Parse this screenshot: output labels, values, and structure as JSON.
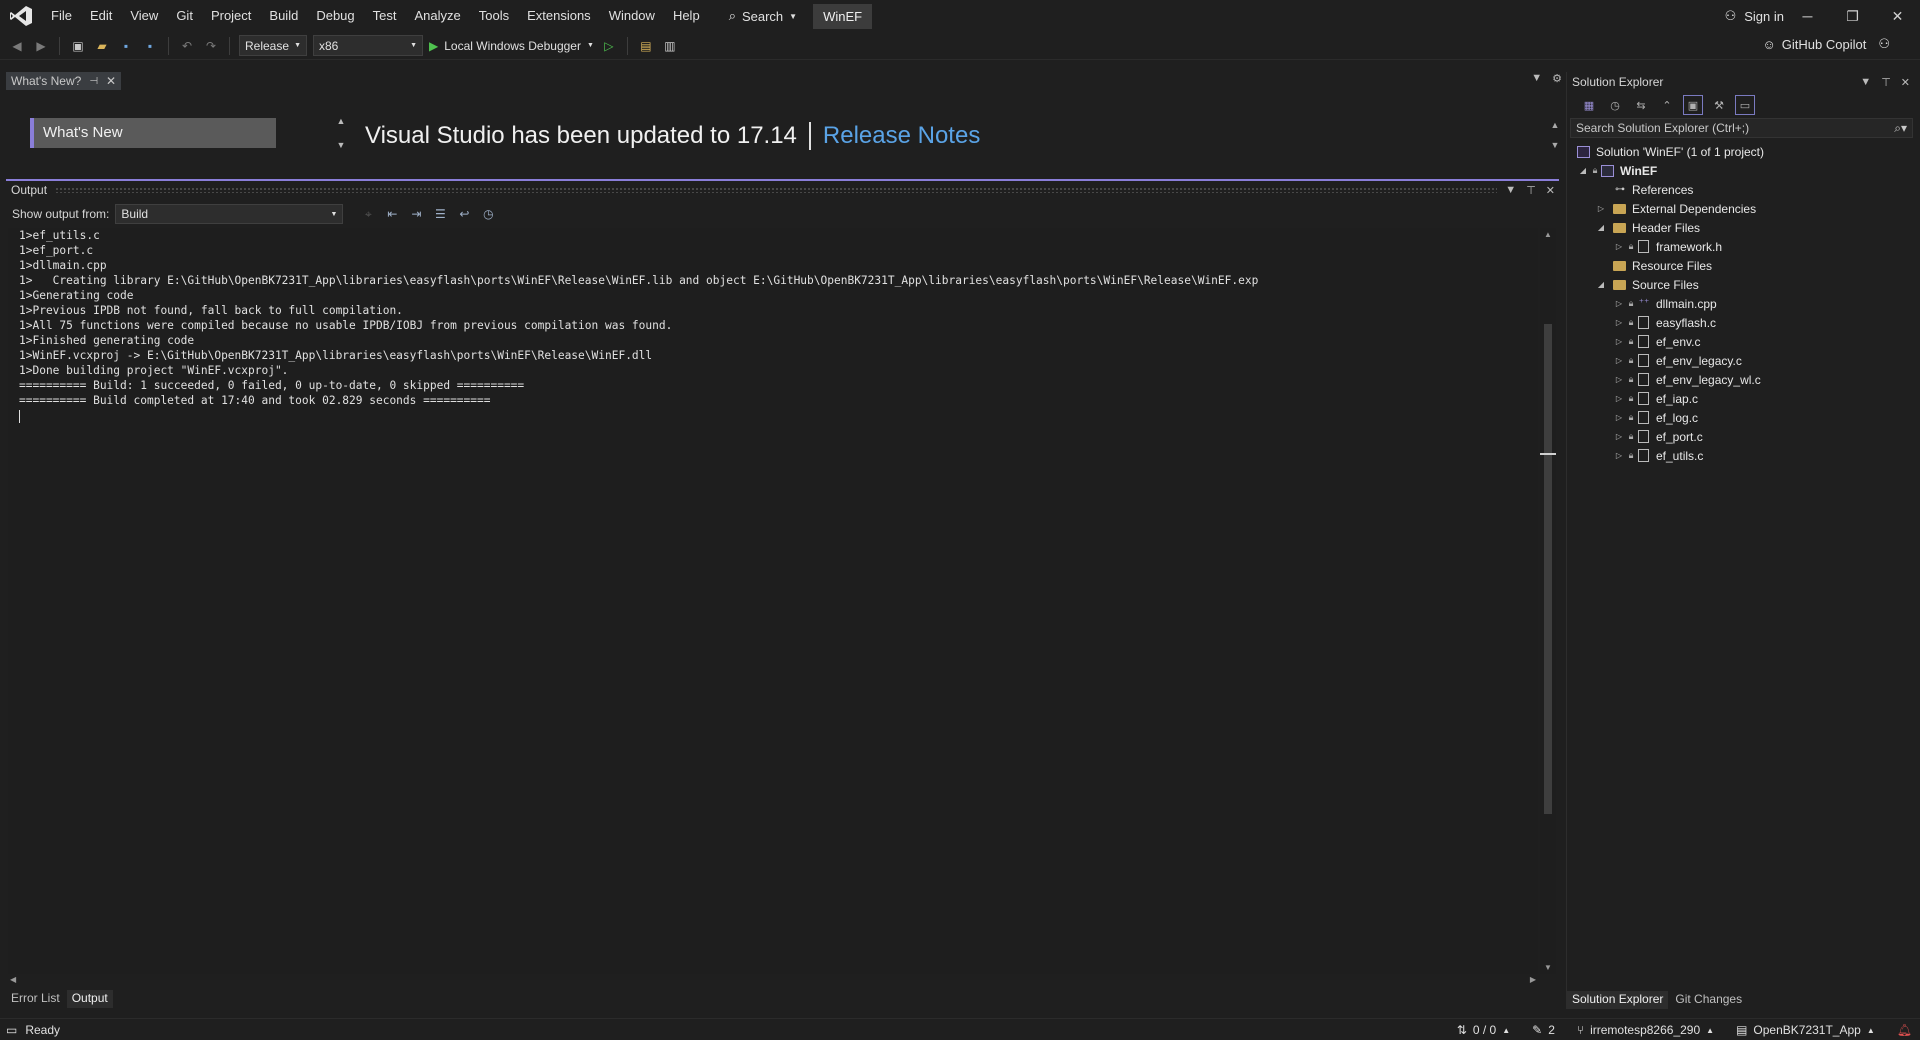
{
  "menu": {
    "items": [
      "File",
      "Edit",
      "View",
      "Git",
      "Project",
      "Build",
      "Debug",
      "Test",
      "Analyze",
      "Tools",
      "Extensions",
      "Window",
      "Help"
    ],
    "search_label": "Search",
    "solution_name": "WinEF",
    "sign_in": "Sign in"
  },
  "toolbar": {
    "configuration": "Release",
    "platform": "x86",
    "debugger": "Local Windows Debugger",
    "copilot": "GitHub Copilot"
  },
  "whats_new": {
    "tab_title": "What's New?",
    "button_label": "What's New",
    "headline": "Visual Studio has been updated to 17.14",
    "link": "Release Notes"
  },
  "output": {
    "title": "Output",
    "show_from_label": "Show output from:",
    "source": "Build",
    "lines": [
      "1>ef_utils.c",
      "1>ef_port.c",
      "1>dllmain.cpp",
      "1>   Creating library E:\\GitHub\\OpenBK7231T_App\\libraries\\easyflash\\ports\\WinEF\\Release\\WinEF.lib and object E:\\GitHub\\OpenBK7231T_App\\libraries\\easyflash\\ports\\WinEF\\Release\\WinEF.exp",
      "1>Generating code",
      "1>Previous IPDB not found, fall back to full compilation.",
      "1>All 75 functions were compiled because no usable IPDB/IOBJ from previous compilation was found.",
      "1>Finished generating code",
      "1>WinEF.vcxproj -> E:\\GitHub\\OpenBK7231T_App\\libraries\\easyflash\\ports\\WinEF\\Release\\WinEF.dll",
      "1>Done building project \"WinEF.vcxproj\".",
      "========== Build: 1 succeeded, 0 failed, 0 up-to-date, 0 skipped ==========",
      "========== Build completed at 17:40 and took 02.829 seconds =========="
    ]
  },
  "bottom_tabs": [
    "Error List",
    "Output"
  ],
  "solution_explorer": {
    "title": "Solution Explorer",
    "search_placeholder": "Search Solution Explorer (Ctrl+;)",
    "solution_label": "Solution 'WinEF' (1 of 1 project)",
    "project": "WinEF",
    "references": "References",
    "external_deps": "External Dependencies",
    "header_files": "Header Files",
    "header_items": [
      "framework.h"
    ],
    "resource_files": "Resource Files",
    "source_files": "Source Files",
    "source_items": [
      "dllmain.cpp",
      "easyflash.c",
      "ef_env.c",
      "ef_env_legacy.c",
      "ef_env_legacy_wl.c",
      "ef_iap.c",
      "ef_log.c",
      "ef_port.c",
      "ef_utils.c"
    ],
    "tabs": [
      "Solution Explorer",
      "Git Changes"
    ]
  },
  "status": {
    "ready": "Ready",
    "line_counter": "0 / 0",
    "pen_count": "2",
    "repo_branch": "irremotesp8266_290",
    "repo_name": "OpenBK7231T_App"
  },
  "colors": {
    "accent": "#8a7ed9",
    "link": "#5aa3e6",
    "background": "#1f1f1f"
  }
}
